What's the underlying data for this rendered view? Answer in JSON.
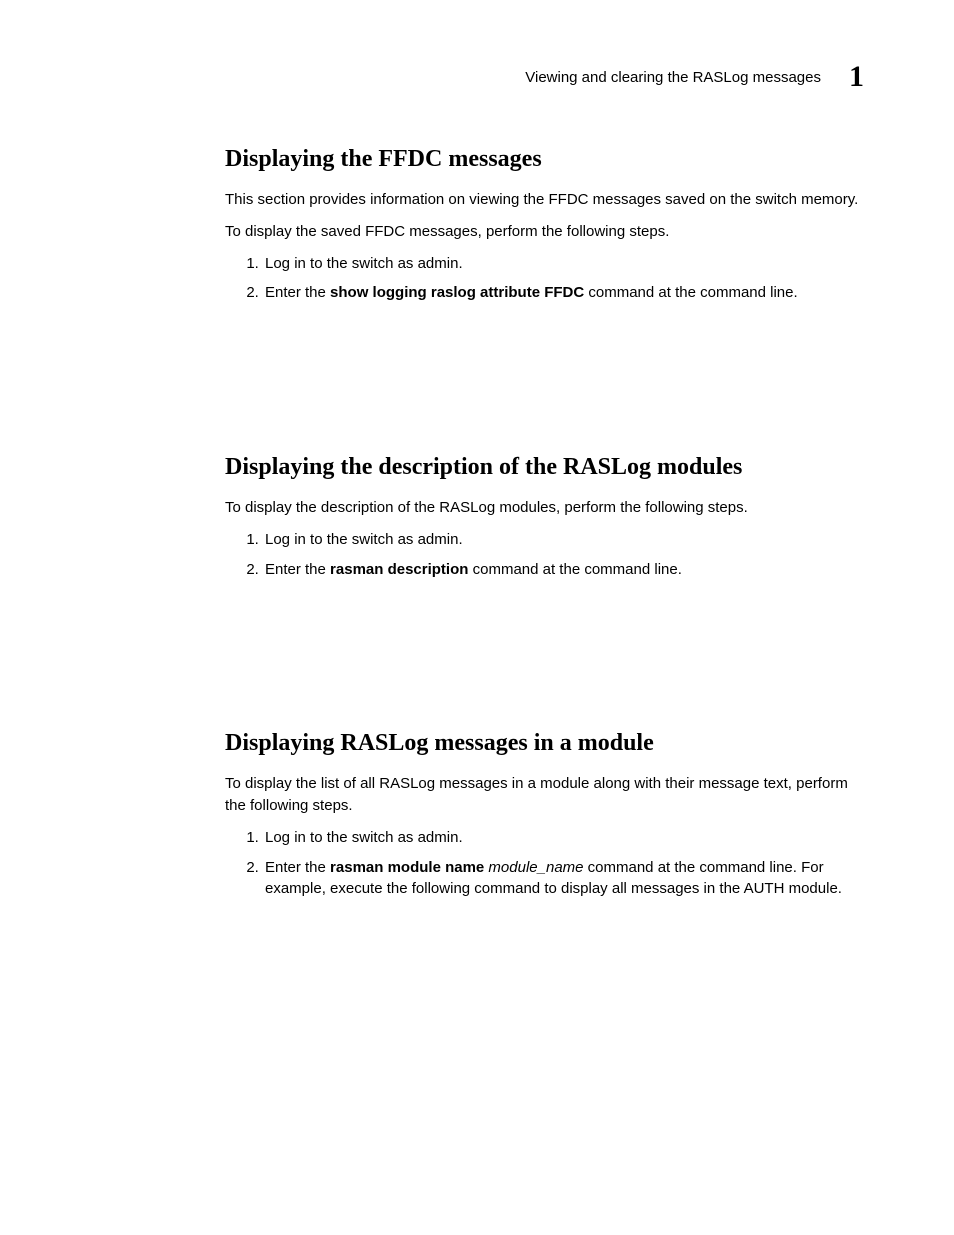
{
  "header": {
    "title": "Viewing and clearing the RASLog messages",
    "chapter_number": "1"
  },
  "sections": [
    {
      "title": "Displaying the FFDC messages",
      "paragraphs": [
        "This section provides information on viewing the FFDC messages saved on the switch memory.",
        "To display the saved FFDC messages, perform the following steps."
      ],
      "steps": [
        {
          "pre": "Log in to the switch as admin."
        },
        {
          "pre": "Enter the ",
          "cmd": "show logging raslog attribute FFDC",
          "post": " command at the command line."
        }
      ]
    },
    {
      "title": "Displaying the description of the RASLog modules",
      "paragraphs": [
        "To display the description of the RASLog modules, perform the following steps."
      ],
      "steps": [
        {
          "pre": "Log in to the switch as admin."
        },
        {
          "pre": "Enter the ",
          "cmd": "rasman description",
          "post": " command at the command line."
        }
      ]
    },
    {
      "title": "Displaying RASLog messages in a module",
      "paragraphs": [
        "To display the list of all RASLog messages in a module along with their message text, perform the following steps."
      ],
      "steps": [
        {
          "pre": "Log in to the switch as admin."
        },
        {
          "pre": "Enter the ",
          "cmd": "rasman module name",
          "arg": " module_name",
          "post": " command at the command line. For example, execute the following command to display all messages in the AUTH module."
        }
      ]
    }
  ]
}
